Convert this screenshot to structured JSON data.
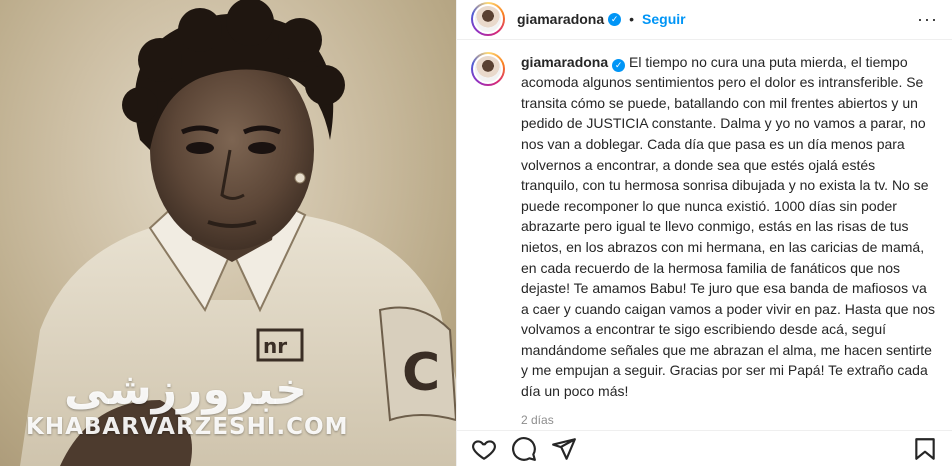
{
  "watermark": {
    "fa": "خبرورزشی",
    "en": "KHABARVARZESHI.COM"
  },
  "header": {
    "username": "giamaradona",
    "separator": "•",
    "follow_label": "Seguir",
    "more_label": "···"
  },
  "caption": {
    "username": "giamaradona",
    "text": "El tiempo no cura una puta mierda, el tiempo acomoda algunos sentimientos pero el dolor es intransferible. Se transita cómo se puede, batallando con mil frentes abiertos y un pedido de JUSTICIA constante. Dalma y yo no vamos a parar, no nos van a doblegar. Cada día que pasa es un día menos para volvernos a encontrar, a donde sea que estés ojalá estés tranquilo, con tu hermosa sonrisa dibujada y no exista la tv. No se puede recomponer lo que nunca existió. 1000 días sin poder abrazarte pero igual te llevo conmigo, estás en las risas de tus nietos, en los abrazos con mi hermana, en las caricias de mamá, en cada recuerdo de la hermosa familia de fanáticos que nos dejaste! Te amamos Babu! Te juro que esa banda de mafiosos va a caer y cuando caigan vamos a poder vivir en paz. Hasta que nos volvamos a encontrar te sigo escribiendo desde acá, seguí mandándome señales que me abrazan el alma, me hacen sentirte y me empujan a seguir. Gracias por ser mi Papá! Te extraño cada día un poco más!",
    "date": "2 días"
  },
  "icons": {
    "verified": "verified-badge-icon",
    "like": "heart-icon",
    "comment": "comment-icon",
    "share": "share-icon",
    "save": "bookmark-icon"
  },
  "colors": {
    "accent": "#0095f6",
    "text": "#262626",
    "muted": "#8e8e8e",
    "border": "#efefef"
  }
}
